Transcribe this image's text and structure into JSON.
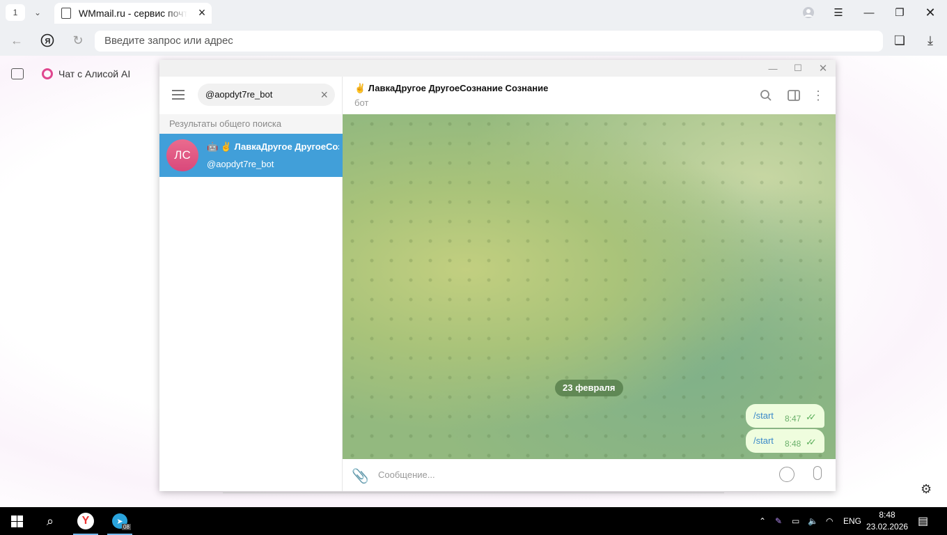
{
  "browser": {
    "tab_count": "1",
    "tab_title": "WMmail.ru - сервис почтовых рассылок",
    "address_placeholder": "Введите запрос или адрес",
    "bookmark_alice": "Чат с Алисой AI"
  },
  "telegram": {
    "search_value": "@aopdyt7re_bot",
    "section_header": "Результаты общего поиска",
    "result": {
      "avatar_initials": "ЛС",
      "name": "🤖 ✌️ ЛавкаДругое ДругоеСознание Сознание",
      "username": "@aopdyt7re_bot"
    },
    "chat": {
      "title": "✌️ ЛавкаДругое ДругоеСознание Сознание",
      "subtitle": "бот",
      "date_badge": "23 февраля",
      "messages": [
        {
          "text": "/start",
          "time": "8:47",
          "check": "✓✓"
        },
        {
          "text": "/start",
          "time": "8:48",
          "check": "✓✓"
        }
      ],
      "compose_placeholder": "Сообщение..."
    }
  },
  "taskbar": {
    "telegram_badge": "08",
    "language": "ENG",
    "time": "8:48",
    "date": "23.02.2026"
  }
}
